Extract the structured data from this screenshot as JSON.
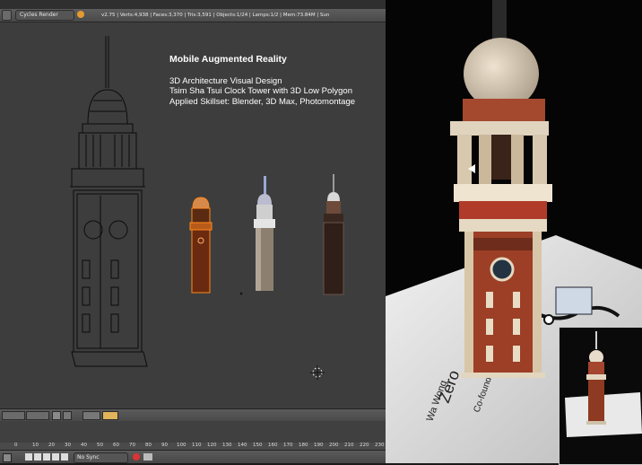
{
  "header": {
    "render_engine": "Cycles Render",
    "stats": "v2.75 | Verts:4,938 | Faces:3,370 | Tris:3,591 | Objects:1/24 | Lamps:1/2 | Mem:73.84M | Sun"
  },
  "overlay": {
    "title": "Mobile Augmented Reality",
    "line1": "3D Architecture  Visual Design",
    "line2": "Tsim Sha Tsui Clock Tower with 3D Low Polygon",
    "line3": "Applied Skillset: Blender, 3D Max, Photomontage"
  },
  "timeline": {
    "ticks": [
      "0",
      "10",
      "20",
      "30",
      "40",
      "50",
      "60",
      "70",
      "80",
      "90",
      "100",
      "110",
      "120",
      "130",
      "140",
      "150",
      "160",
      "170",
      "180",
      "190",
      "200",
      "210",
      "220",
      "230"
    ]
  },
  "playback": {
    "sync": "No Sync"
  },
  "card": {
    "text_zero": "Zero",
    "text_name": "Wa Wong",
    "text_founder": "Co-founder"
  },
  "colors": {
    "accent": "#e07a1a",
    "brick": "#8a3a24"
  }
}
